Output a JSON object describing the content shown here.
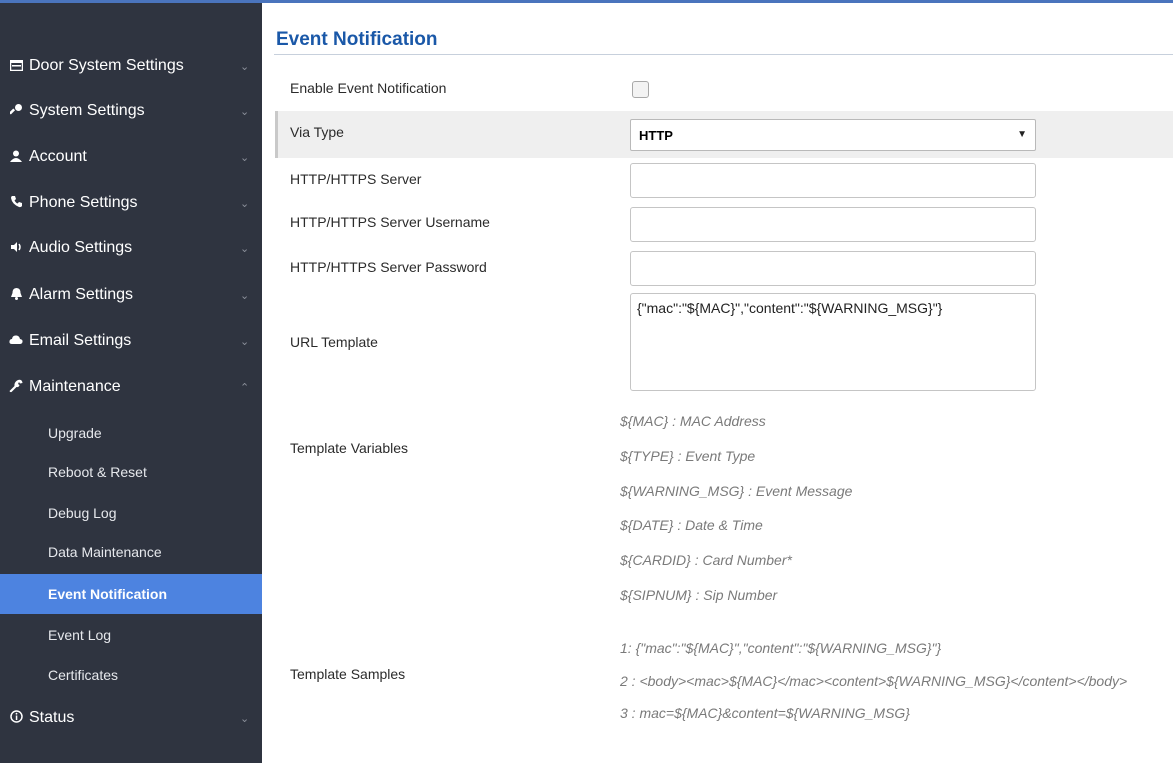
{
  "sidebar": {
    "items": [
      {
        "label": "Door System Settings",
        "icon": "door-settings-icon",
        "chevron": "⌄"
      },
      {
        "label": "System Settings",
        "icon": "key-icon",
        "chevron": "⌄"
      },
      {
        "label": "Account",
        "icon": "user-icon",
        "chevron": "⌄"
      },
      {
        "label": "Phone Settings",
        "icon": "phone-icon",
        "chevron": "⌄"
      },
      {
        "label": "Audio Settings",
        "icon": "speaker-icon",
        "chevron": "⌄"
      },
      {
        "label": "Alarm Settings",
        "icon": "bell-icon",
        "chevron": "⌄"
      },
      {
        "label": "Email Settings",
        "icon": "cloud-icon",
        "chevron": "⌄"
      },
      {
        "label": "Maintenance",
        "icon": "wrench-icon",
        "chevron": "⌃"
      }
    ],
    "sub_items": [
      {
        "label": "Upgrade"
      },
      {
        "label": "Reboot & Reset"
      },
      {
        "label": "Debug Log"
      },
      {
        "label": "Data Maintenance"
      },
      {
        "label": "Event Notification",
        "active": true
      },
      {
        "label": "Event Log"
      },
      {
        "label": "Certificates"
      }
    ],
    "status": {
      "label": "Status",
      "icon": "info-icon",
      "chevron": "⌄"
    }
  },
  "main": {
    "title": "Event Notification",
    "enable_label": "Enable Event Notification",
    "enable_checked": false,
    "via_type_label": "Via Type",
    "via_type_value": "HTTP",
    "server_label": "HTTP/HTTPS Server",
    "server_value": "",
    "username_label": "HTTP/HTTPS Server Username",
    "username_value": "",
    "password_label": "HTTP/HTTPS Server Password",
    "password_value": "",
    "url_template_label": "URL Template",
    "url_template_value": "{\"mac\":\"${MAC}\",\"content\":\"${WARNING_MSG}\"}",
    "template_variables_label": "Template Variables",
    "template_variables": [
      "${MAC} : MAC Address",
      "${TYPE} : Event Type",
      "${WARNING_MSG} : Event Message",
      "${DATE} : Date & Time",
      "${CARDID} : Card Number*",
      "${SIPNUM} : Sip Number"
    ],
    "template_samples_label": "Template Samples",
    "template_samples": [
      "1: {\"mac\":\"${MAC}\",\"content\":\"${WARNING_MSG}\"}",
      "2 : <body><mac>${MAC}</mac><content>${WARNING_MSG}</content></body>",
      "3 : mac=${MAC}&content=${WARNING_MSG}"
    ]
  },
  "colors": {
    "sidebar_bg": "#2f3440",
    "active_item": "#4d83e0",
    "title": "#1a58a8"
  }
}
